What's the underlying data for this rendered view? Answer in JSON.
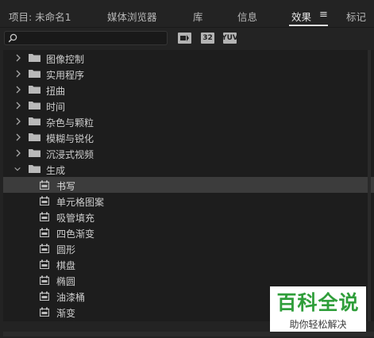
{
  "tabs": [
    {
      "label": "项目: 未命名1"
    },
    {
      "label": "媒体浏览器"
    },
    {
      "label": "库"
    },
    {
      "label": "信息"
    },
    {
      "label": "效果"
    },
    {
      "label": "标记"
    }
  ],
  "active_tab": "效果",
  "search": {
    "value": "",
    "placeholder": ""
  },
  "toolbar": {
    "accel_icon": "accelerated-effects-icon",
    "bit32_label": "32",
    "yuv_label": "YUV"
  },
  "tree": {
    "folders": [
      {
        "label": "图像控制"
      },
      {
        "label": "实用程序"
      },
      {
        "label": "扭曲"
      },
      {
        "label": "时间"
      },
      {
        "label": "杂色与颗粒"
      },
      {
        "label": "模糊与锐化"
      },
      {
        "label": "沉浸式视频"
      },
      {
        "label": "生成"
      }
    ],
    "expanded_folder": "生成",
    "effects": [
      {
        "label": "书写"
      },
      {
        "label": "单元格图案"
      },
      {
        "label": "吸管填充"
      },
      {
        "label": "四色渐变"
      },
      {
        "label": "圆形"
      },
      {
        "label": "棋盘"
      },
      {
        "label": "椭圆"
      },
      {
        "label": "油漆桶"
      },
      {
        "label": "渐变"
      }
    ],
    "selected_effect": "书写"
  },
  "watermark": {
    "title": "百科全说",
    "subtitle": "助你轻松解决"
  },
  "colors": {
    "background": "#232323",
    "list_bg": "#1d1d1d",
    "selected_row": "#3c3c3c",
    "watermark_green": "#2f9e3a"
  }
}
